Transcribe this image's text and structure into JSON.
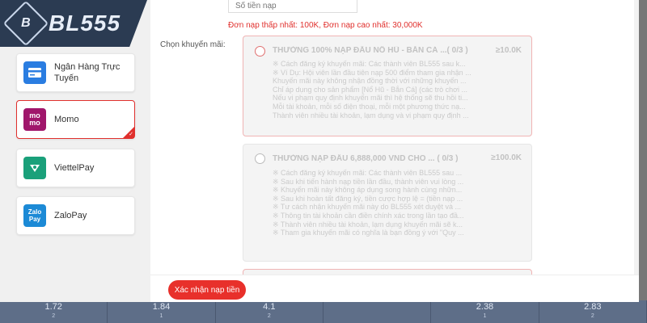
{
  "brand": {
    "logo_mark": "B",
    "logo_text": "BL555"
  },
  "payment_methods": [
    {
      "label": "Ngân Hàng Trực Tuyến",
      "icon": "bank-card-icon",
      "color": "#2a7de1",
      "active": false
    },
    {
      "label": "Momo",
      "icon": "momo-icon",
      "icon_text": "mo mo",
      "color": "#a0166b",
      "active": true
    },
    {
      "label": "ViettelPay",
      "icon": "viettelpay-icon",
      "color": "#1aa07a",
      "active": false
    },
    {
      "label": "ZaloPay",
      "icon": "zalopay-icon",
      "icon_text": "Zalo Pay",
      "color": "#1c8ad6",
      "active": false
    }
  ],
  "amount": {
    "placeholder": "Số tiền nạp"
  },
  "limits": {
    "min_label": "Đơn nạp thấp nhất:",
    "min_value": "100K",
    "sep": ",",
    "max_label": "Đơn nạp cao nhất:",
    "max_value": "30,000K"
  },
  "promo_label": "Chọn khuyến mãi:",
  "promos": [
    {
      "title": "THƯỞNG 100% NẠP ĐẦU NỔ HŨ - BẮN CÁ ...( 0/3 )",
      "amount": "≥10.0K",
      "lines": [
        "※ Cách đăng ký khuyến mãi: Các thành viên BL555 sau k...",
        "※ Ví Dụ: Hội viên lần đầu tiên nạp 500 điểm tham gia nhận ...",
        "Khuyến mãi này không nhận đồng thời với những khuyến ...",
        "Chỉ áp dụng cho sản phẩm [Nổ Hũ - Bắn Cá] (các trò chơi ...",
        "Nếu vi phạm quy định khuyến mãi thì hệ thống sẽ thu hồi ti...",
        "Mỗi tài khoản, mỗi số điện thoại, mỗi một phương thức nạ...",
        "Thành viên nhiều tài khoản, lạm dụng và vi phạm quy định ..."
      ]
    },
    {
      "title": "THƯỞNG NẠP ĐẦU 6,888,000 VND CHO ... ( 0/3 )",
      "amount": "≥100.0K",
      "lines": [
        "※ Cách đăng ký khuyến mãi: Các thành viên BL555 sau ...",
        "※ Sau khi tiến hành nạp tiền lần đầu, thành viên vui lòng ...",
        "※ Khuyến mãi này không áp dụng song hành cùng nhữn...",
        "※ Sau khi hoàn tất đăng ký, tiền cược hợp lệ = (tiền nạp ...",
        "※ Tư cách nhận khuyến mãi này do BL555 xét duyệt và ...",
        "※ Thông tin tài khoản cần điền chính xác trong lần tạo đầ...",
        "※ Thành viên nhiều tài khoản, lạm dụng khuyến mãi sẽ k...",
        "※ Tham gia khuyến mãi có nghĩa là bạn đồng ý với \"Quy ..."
      ]
    }
  ],
  "confirm_label": "Xác nhận nạp tiền",
  "odds": [
    {
      "value": "1.72",
      "sub": "2"
    },
    {
      "value": "1.84",
      "sub": "1"
    },
    {
      "value": "4.1",
      "sub": "2"
    },
    {
      "value": "",
      "sub": ""
    },
    {
      "value": "2.38",
      "sub": "1"
    },
    {
      "value": "2.83",
      "sub": "2"
    }
  ],
  "colors": {
    "accent": "#e8302b",
    "logo_bg": "#2b3b52"
  }
}
